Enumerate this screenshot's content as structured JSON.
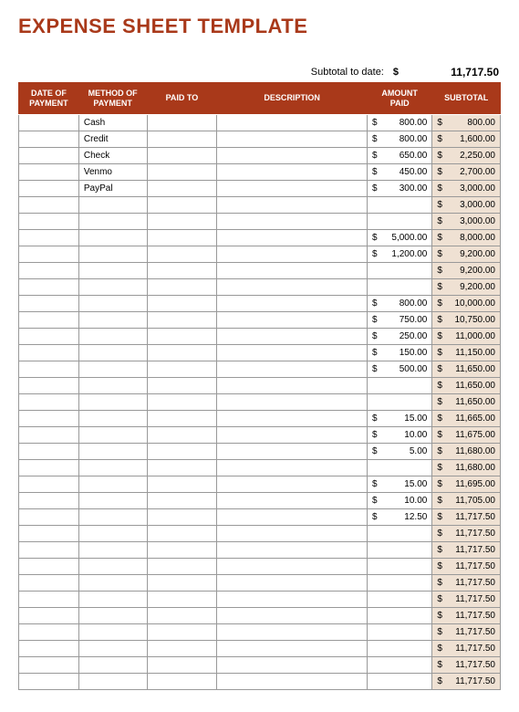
{
  "title": "EXPENSE SHEET TEMPLATE",
  "subtotal_header": {
    "label": "Subtotal to date:",
    "currency": "$",
    "value": "11,717.50"
  },
  "headers": {
    "date": "DATE OF PAYMENT",
    "method": "METHOD OF PAYMENT",
    "paid_to": "PAID TO",
    "description": "DESCRIPTION",
    "amount": "AMOUNT PAID",
    "subtotal": "SUBTOTAL"
  },
  "currency_symbol": "$",
  "rows": [
    {
      "date": "",
      "method": "Cash",
      "paid_to": "",
      "description": "",
      "amount": "800.00",
      "subtotal": "800.00"
    },
    {
      "date": "",
      "method": "Credit",
      "paid_to": "",
      "description": "",
      "amount": "800.00",
      "subtotal": "1,600.00"
    },
    {
      "date": "",
      "method": "Check",
      "paid_to": "",
      "description": "",
      "amount": "650.00",
      "subtotal": "2,250.00"
    },
    {
      "date": "",
      "method": "Venmo",
      "paid_to": "",
      "description": "",
      "amount": "450.00",
      "subtotal": "2,700.00"
    },
    {
      "date": "",
      "method": "PayPal",
      "paid_to": "",
      "description": "",
      "amount": "300.00",
      "subtotal": "3,000.00"
    },
    {
      "date": "",
      "method": "",
      "paid_to": "",
      "description": "",
      "amount": "",
      "subtotal": "3,000.00"
    },
    {
      "date": "",
      "method": "",
      "paid_to": "",
      "description": "",
      "amount": "",
      "subtotal": "3,000.00"
    },
    {
      "date": "",
      "method": "",
      "paid_to": "",
      "description": "",
      "amount": "5,000.00",
      "subtotal": "8,000.00"
    },
    {
      "date": "",
      "method": "",
      "paid_to": "",
      "description": "",
      "amount": "1,200.00",
      "subtotal": "9,200.00"
    },
    {
      "date": "",
      "method": "",
      "paid_to": "",
      "description": "",
      "amount": "",
      "subtotal": "9,200.00"
    },
    {
      "date": "",
      "method": "",
      "paid_to": "",
      "description": "",
      "amount": "",
      "subtotal": "9,200.00"
    },
    {
      "date": "",
      "method": "",
      "paid_to": "",
      "description": "",
      "amount": "800.00",
      "subtotal": "10,000.00"
    },
    {
      "date": "",
      "method": "",
      "paid_to": "",
      "description": "",
      "amount": "750.00",
      "subtotal": "10,750.00"
    },
    {
      "date": "",
      "method": "",
      "paid_to": "",
      "description": "",
      "amount": "250.00",
      "subtotal": "11,000.00"
    },
    {
      "date": "",
      "method": "",
      "paid_to": "",
      "description": "",
      "amount": "150.00",
      "subtotal": "11,150.00"
    },
    {
      "date": "",
      "method": "",
      "paid_to": "",
      "description": "",
      "amount": "500.00",
      "subtotal": "11,650.00"
    },
    {
      "date": "",
      "method": "",
      "paid_to": "",
      "description": "",
      "amount": "",
      "subtotal": "11,650.00"
    },
    {
      "date": "",
      "method": "",
      "paid_to": "",
      "description": "",
      "amount": "",
      "subtotal": "11,650.00"
    },
    {
      "date": "",
      "method": "",
      "paid_to": "",
      "description": "",
      "amount": "15.00",
      "subtotal": "11,665.00"
    },
    {
      "date": "",
      "method": "",
      "paid_to": "",
      "description": "",
      "amount": "10.00",
      "subtotal": "11,675.00"
    },
    {
      "date": "",
      "method": "",
      "paid_to": "",
      "description": "",
      "amount": "5.00",
      "subtotal": "11,680.00"
    },
    {
      "date": "",
      "method": "",
      "paid_to": "",
      "description": "",
      "amount": "",
      "subtotal": "11,680.00"
    },
    {
      "date": "",
      "method": "",
      "paid_to": "",
      "description": "",
      "amount": "15.00",
      "subtotal": "11,695.00"
    },
    {
      "date": "",
      "method": "",
      "paid_to": "",
      "description": "",
      "amount": "10.00",
      "subtotal": "11,705.00"
    },
    {
      "date": "",
      "method": "",
      "paid_to": "",
      "description": "",
      "amount": "12.50",
      "subtotal": "11,717.50"
    },
    {
      "date": "",
      "method": "",
      "paid_to": "",
      "description": "",
      "amount": "",
      "subtotal": "11,717.50"
    },
    {
      "date": "",
      "method": "",
      "paid_to": "",
      "description": "",
      "amount": "",
      "subtotal": "11,717.50"
    },
    {
      "date": "",
      "method": "",
      "paid_to": "",
      "description": "",
      "amount": "",
      "subtotal": "11,717.50"
    },
    {
      "date": "",
      "method": "",
      "paid_to": "",
      "description": "",
      "amount": "",
      "subtotal": "11,717.50"
    },
    {
      "date": "",
      "method": "",
      "paid_to": "",
      "description": "",
      "amount": "",
      "subtotal": "11,717.50"
    },
    {
      "date": "",
      "method": "",
      "paid_to": "",
      "description": "",
      "amount": "",
      "subtotal": "11,717.50"
    },
    {
      "date": "",
      "method": "",
      "paid_to": "",
      "description": "",
      "amount": "",
      "subtotal": "11,717.50"
    },
    {
      "date": "",
      "method": "",
      "paid_to": "",
      "description": "",
      "amount": "",
      "subtotal": "11,717.50"
    },
    {
      "date": "",
      "method": "",
      "paid_to": "",
      "description": "",
      "amount": "",
      "subtotal": "11,717.50"
    },
    {
      "date": "",
      "method": "",
      "paid_to": "",
      "description": "",
      "amount": "",
      "subtotal": "11,717.50"
    }
  ]
}
